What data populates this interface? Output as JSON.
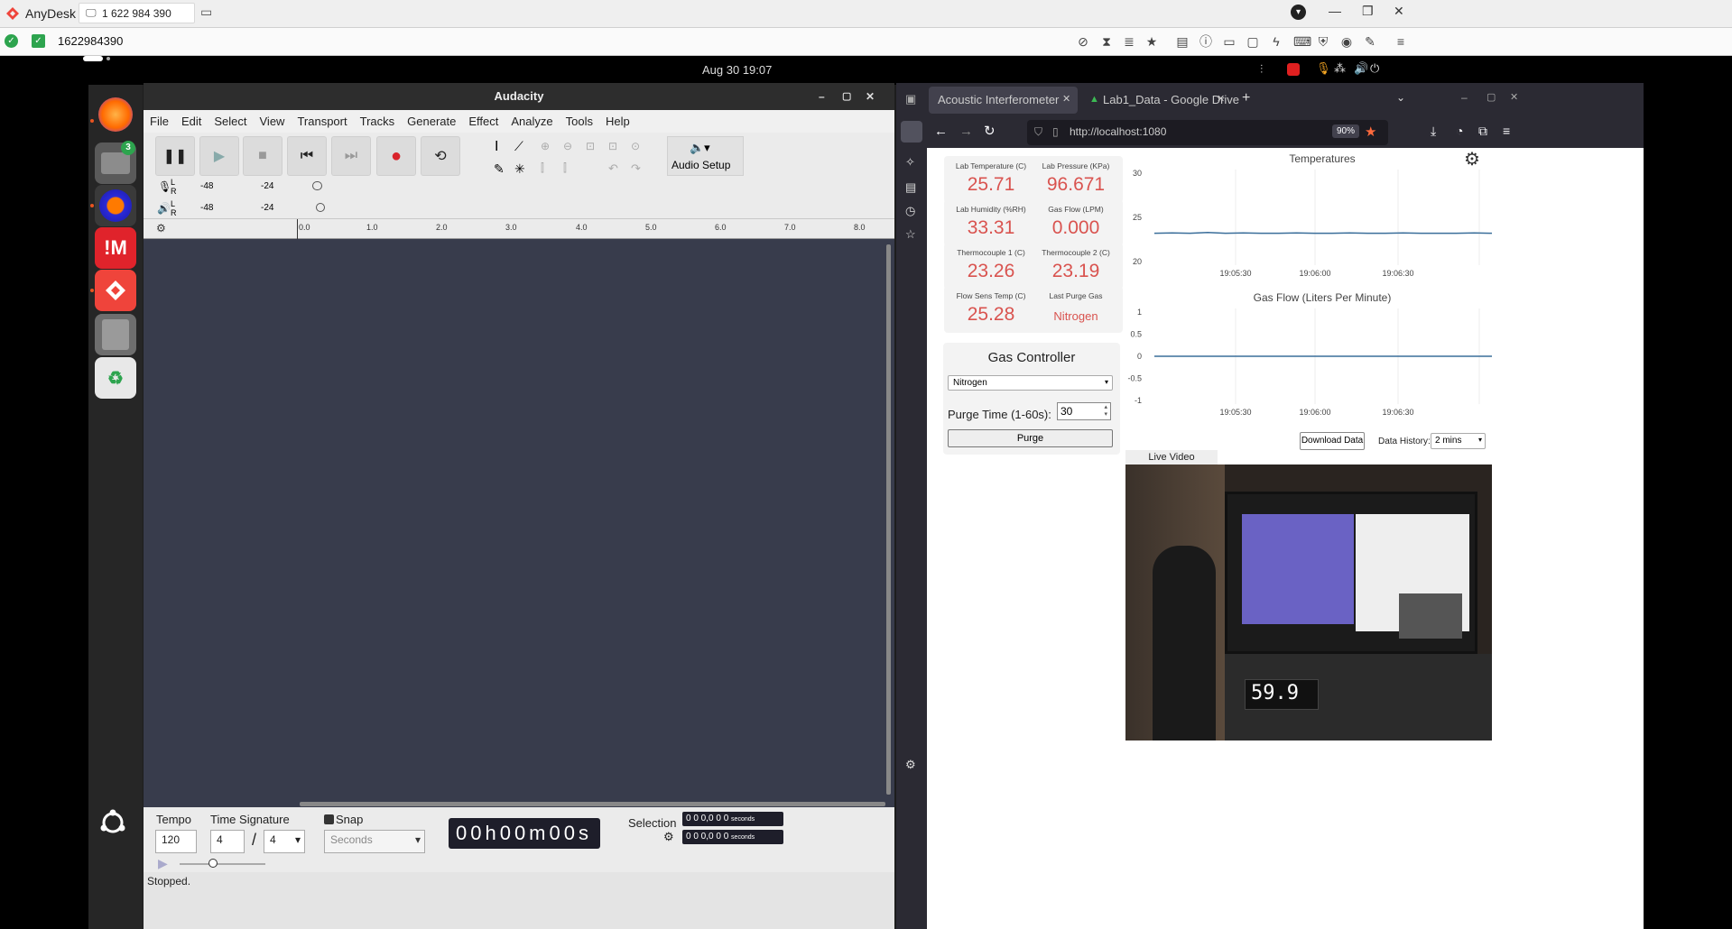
{
  "anydesk": {
    "app_name": "AnyDesk",
    "session_tab": "1 622 984 390",
    "address": "1622984390"
  },
  "remote": {
    "clock": "Aug 30  19:07",
    "dock": [
      {
        "name": "firefox-icon"
      },
      {
        "name": "files-icon",
        "badge": "3"
      },
      {
        "name": "audacity-icon"
      },
      {
        "name": "mattermost-icon",
        "glyph": "!M"
      },
      {
        "name": "anydesk-icon"
      },
      {
        "name": "drive-icon"
      },
      {
        "name": "trash-icon",
        "glyph": "♻"
      }
    ]
  },
  "audacity": {
    "title": "Audacity",
    "menu": [
      "File",
      "Edit",
      "Select",
      "View",
      "Transport",
      "Tracks",
      "Generate",
      "Effect",
      "Analyze",
      "Tools",
      "Help"
    ],
    "audio_setup": "Audio Setup",
    "meter_rec": [
      "-48",
      "-24"
    ],
    "meter_play": [
      "-48",
      "-24"
    ],
    "meter_lr": [
      "L",
      "R"
    ],
    "ruler_ticks": [
      "0.0",
      "1.0",
      "2.0",
      "3.0",
      "4.0",
      "5.0",
      "6.0",
      "7.0",
      "8.0"
    ],
    "tempo_label": "Tempo",
    "tempo_value": "120",
    "time_sig_label": "Time Signature",
    "time_sig_num": "4",
    "time_sig_slash": "/",
    "time_sig_den": "4",
    "snap_label": "Snap",
    "snap_unit": "Seconds",
    "time_display": "00h00m00s",
    "selection_label": "Selection",
    "selection_start": "0 0 0,0 0 0",
    "selection_end": "0 0 0,0 0 0",
    "selection_unit": "seconds",
    "status": "Stopped."
  },
  "firefox": {
    "tabs": [
      {
        "label": "Acoustic Interferometer",
        "active": true
      },
      {
        "label": "Lab1_Data - Google Drive",
        "active": false
      }
    ],
    "url": "http://localhost:1080",
    "zoom": "90%"
  },
  "dashboard": {
    "metrics": [
      {
        "label": "Lab Temperature (C)",
        "value": "25.71"
      },
      {
        "label": "Lab Pressure (KPa)",
        "value": "96.671"
      },
      {
        "label": "Lab Humidity (%RH)",
        "value": "33.31"
      },
      {
        "label": "Gas Flow (LPM)",
        "value": "0.000"
      },
      {
        "label": "Thermocouple 1 (C)",
        "value": "23.26"
      },
      {
        "label": "Thermocouple 2 (C)",
        "value": "23.19"
      },
      {
        "label": "Flow Sens Temp (C)",
        "value": "25.28"
      },
      {
        "label": "Last Purge Gas",
        "value": "Nitrogen"
      }
    ],
    "gas_controller": {
      "title": "Gas Controller",
      "gas": "Nitrogen",
      "purge_label": "Purge Time (1-60s):",
      "purge_value": "30",
      "purge_button": "Purge"
    },
    "download_button": "Download Data",
    "history_label": "Data History:",
    "history_value": "2 mins",
    "live_video_label": "Live Video",
    "video_readout": "59.9"
  },
  "chart_data": [
    {
      "type": "line",
      "title": "Temperatures",
      "x_ticks": [
        "19:05:30",
        "19:06:00",
        "19:06:30"
      ],
      "ylim": [
        20,
        30
      ],
      "y_ticks": [
        "30",
        "25",
        "20"
      ],
      "grid": true,
      "series": [
        {
          "values": [
            23.2,
            23.25,
            23.2,
            23.3,
            23.2,
            23.25,
            23.2,
            23.2,
            23.25,
            23.2,
            23.2,
            23.25,
            23.2,
            23.2,
            23.25,
            23.2,
            23.2,
            23.2,
            23.25,
            23.2
          ],
          "color": "#3a6e9a"
        }
      ]
    },
    {
      "type": "line",
      "title": "Gas Flow (Liters Per Minute)",
      "x_ticks": [
        "19:05:30",
        "19:06:00",
        "19:06:30"
      ],
      "ylim": [
        -1,
        1
      ],
      "y_ticks": [
        "1",
        "0.5",
        "0",
        "-0.5",
        "-1"
      ],
      "grid": true,
      "series": [
        {
          "values": [
            0,
            0,
            0,
            0,
            0,
            0,
            0,
            0,
            0,
            0,
            0,
            0,
            0,
            0,
            0,
            0,
            0,
            0,
            0,
            0
          ],
          "color": "#3a6e9a"
        }
      ]
    }
  ]
}
